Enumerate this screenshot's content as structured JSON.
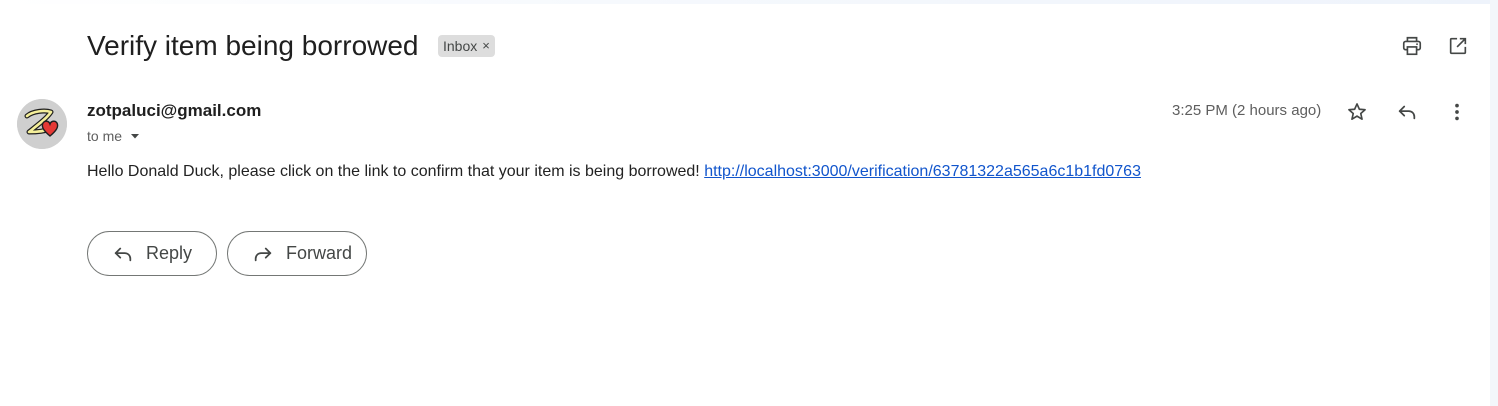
{
  "email": {
    "subject": "Verify item being borrowed",
    "label_chip": "Inbox",
    "label_chip_remove": "×",
    "sender_email": "zotpaluci@gmail.com",
    "recipient_text": "to me",
    "timestamp": "3:25 PM (2 hours ago)",
    "body_text": "Hello Donald Duck, please click on the link to confirm that your item is being borrowed!",
    "body_link": "http://localhost:3000/verification/63781322a565a6c1b1fd0763"
  },
  "actions": {
    "reply_label": "Reply",
    "forward_label": "Forward"
  },
  "icons": {
    "print": "print-icon",
    "open_new_window": "open-in-new-window-icon",
    "star": "star-icon",
    "reply": "reply-icon",
    "more": "more-vertical-icon",
    "caret": "chevron-down-icon",
    "forward": "forward-icon"
  },
  "colors": {
    "link": "#1155cc",
    "chip_background": "#dddddd",
    "avatar_heart": "#e53935",
    "avatar_letter": "#f4ef9a"
  }
}
